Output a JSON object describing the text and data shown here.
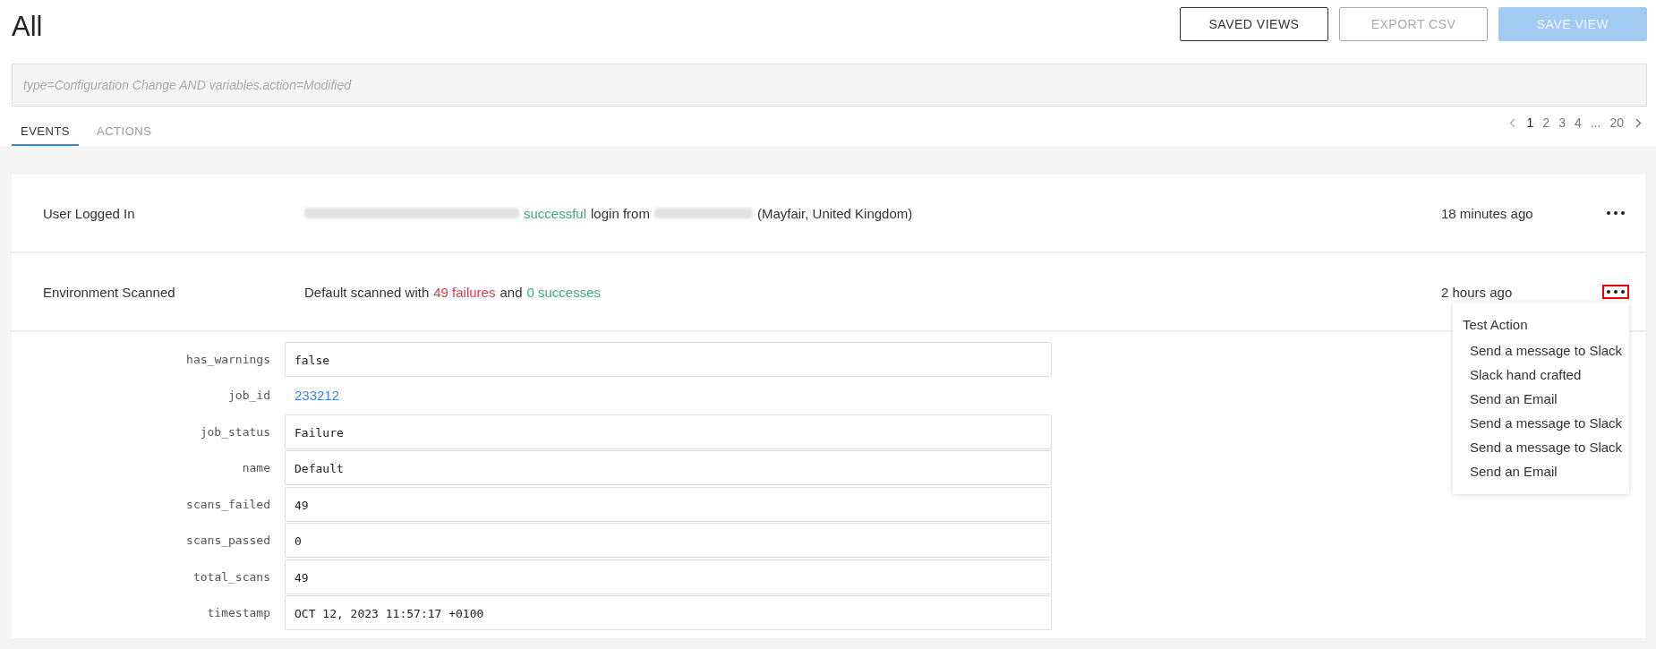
{
  "page": {
    "title": "All"
  },
  "buttons": [
    {
      "label": "SAVED VIEWS",
      "kind": "outline",
      "disabled": false
    },
    {
      "label": "EXPORT CSV",
      "kind": "outline",
      "disabled": true
    },
    {
      "label": "SAVE VIEW",
      "kind": "primary",
      "disabled": true
    }
  ],
  "search": {
    "placeholder": "type=Configuration Change AND variables.action=Modified"
  },
  "tabs": [
    {
      "label": "EVENTS",
      "selected": true
    },
    {
      "label": "ACTIONS",
      "selected": false
    }
  ],
  "pagination": {
    "pages": [
      {
        "label": "1",
        "selected": true
      },
      {
        "label": "2",
        "selected": false
      },
      {
        "label": "3",
        "selected": false
      },
      {
        "label": "4",
        "selected": false
      },
      {
        "label": "...",
        "selected": false
      },
      {
        "label": "20",
        "selected": false
      }
    ]
  },
  "events": [
    {
      "name": "User Logged In",
      "time": "18 minutes ago",
      "focused": false,
      "description": [
        {
          "kind": "redacted"
        },
        {
          "kind": "success",
          "text": "successful"
        },
        {
          "kind": "plain",
          "text": "login from"
        },
        {
          "kind": "redacted"
        },
        {
          "kind": "plain",
          "text": "(Mayfair, United Kingdom)"
        }
      ]
    },
    {
      "name": "Environment Scanned",
      "time": "2 hours ago",
      "focused": true,
      "description": [
        {
          "kind": "plain",
          "text": "Default scanned with"
        },
        {
          "kind": "failure",
          "text": "49 failures"
        },
        {
          "kind": "plain",
          "text": "and"
        },
        {
          "kind": "success",
          "text": "0 successes"
        }
      ],
      "menu": {
        "title": "Test Action",
        "items": [
          "Send a message to Slack",
          "Slack hand crafted",
          "Send an Email",
          "Send a message to Slack",
          "Send a message to Slack",
          "Send an Email"
        ]
      },
      "details": [
        {
          "key": "has_warnings",
          "value": "false",
          "kind": "field"
        },
        {
          "key": "job_id",
          "value": "233212",
          "kind": "link"
        },
        {
          "key": "job_status",
          "value": "Failure",
          "kind": "field"
        },
        {
          "key": "name",
          "value": "Default",
          "kind": "field"
        },
        {
          "key": "scans_failed",
          "value": "49",
          "kind": "field"
        },
        {
          "key": "scans_passed",
          "value": "0",
          "kind": "field"
        },
        {
          "key": "total_scans",
          "value": "49",
          "kind": "field"
        },
        {
          "key": "timestamp",
          "value": "OCT 12, 2023 11:57:17 +0100",
          "kind": "field"
        }
      ]
    }
  ]
}
